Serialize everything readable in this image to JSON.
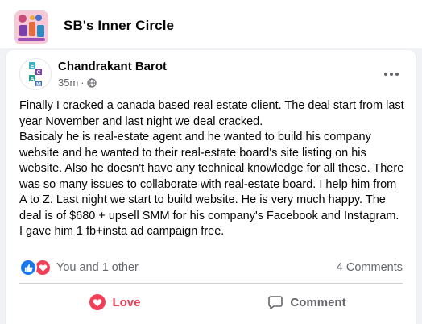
{
  "group": {
    "name": "SB's Inner Circle"
  },
  "post": {
    "author": "Chandrakant Barot",
    "author_avatar_letters": [
      "E",
      "C",
      "A",
      "M"
    ],
    "time": "35m",
    "dot": "·",
    "audience_icon": "globe-icon",
    "body": "Finally I cracked a canada based real estate client. The deal start from last year November and last night we deal cracked.\nBasicaly he is real-estate agent and he wanted to build his company website and he wanted to their real-estate board's site listing on his website. Also he doesn't have any technical knowledge for all these. There was so many issues to collaborate with real-estate board. I help him from A to Z. Last night we start to build website. He is very much happy. The deal is of $680 + upsell SMM for his company's Facebook and Instagram.\nI gave him 1 fb+insta ad campaign free.",
    "reactions": {
      "icons": [
        "like-icon",
        "love-icon"
      ],
      "text": "You and 1 other"
    },
    "comments_count": "4 Comments"
  },
  "actions": {
    "love_label": "Love",
    "comment_label": "Comment"
  },
  "colors": {
    "love": "#f33e58",
    "like": "#1877f2",
    "secondary_text": "#65676b"
  }
}
